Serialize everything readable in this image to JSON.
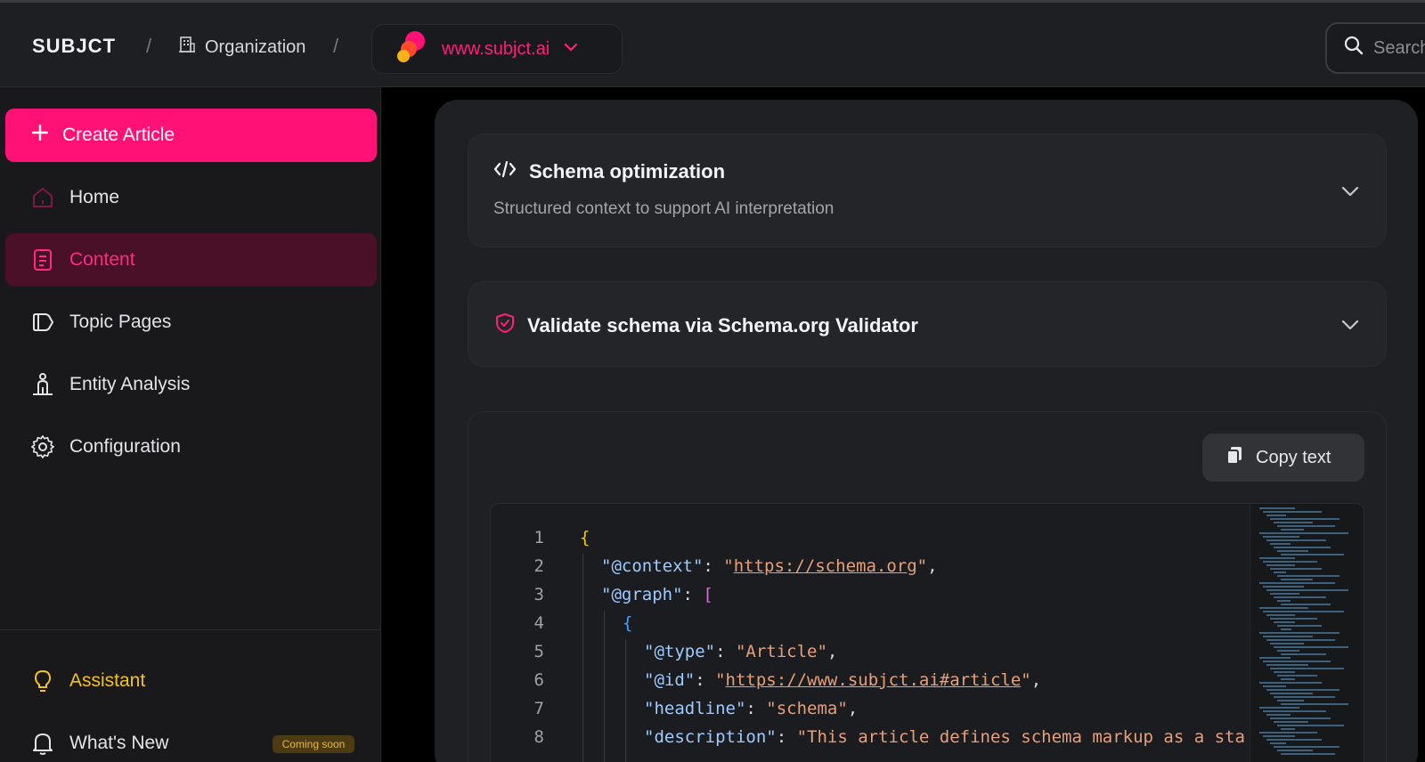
{
  "topbar": {
    "brand": "SUBJCT",
    "separator": "/",
    "organization_label": "Organization",
    "site_label": "www.subjct.ai",
    "search_placeholder": "Search"
  },
  "sidebar": {
    "create_label": "Create Article",
    "items": [
      {
        "label": "Home",
        "icon": "home-icon"
      },
      {
        "label": "Content",
        "icon": "document-icon",
        "active": true
      },
      {
        "label": "Topic Pages",
        "icon": "tag-icon"
      },
      {
        "label": "Entity Analysis",
        "icon": "entity-icon"
      },
      {
        "label": "Configuration",
        "icon": "gear-icon"
      }
    ],
    "assistant_label": "Assistant",
    "whats_new_label": "What's New",
    "coming_soon_badge": "Coming soon"
  },
  "main": {
    "schema_card": {
      "title": "Schema optimization",
      "subtitle": "Structured context to support AI interpretation"
    },
    "validate_card": {
      "title": "Validate schema via Schema.org Validator"
    },
    "copy_label": "Copy text",
    "code_lines": [
      {
        "n": "1"
      },
      {
        "n": "2",
        "key": "\"@context\"",
        "value": "https://schema.org"
      },
      {
        "n": "3",
        "key": "\"@graph\""
      },
      {
        "n": "4"
      },
      {
        "n": "5",
        "key": "\"@type\"",
        "value": "\"Article\""
      },
      {
        "n": "6",
        "key": "\"@id\"",
        "value": "https://www.subjct.ai#article"
      },
      {
        "n": "7",
        "key": "\"headline\"",
        "value": "\"schema\""
      },
      {
        "n": "8",
        "key": "\"description\"",
        "value": "\"This article defines schema markup as a sta"
      }
    ]
  },
  "colors": {
    "accent": "#ff1176",
    "active_bg": "#4a1027",
    "assistant": "#f3c318"
  }
}
